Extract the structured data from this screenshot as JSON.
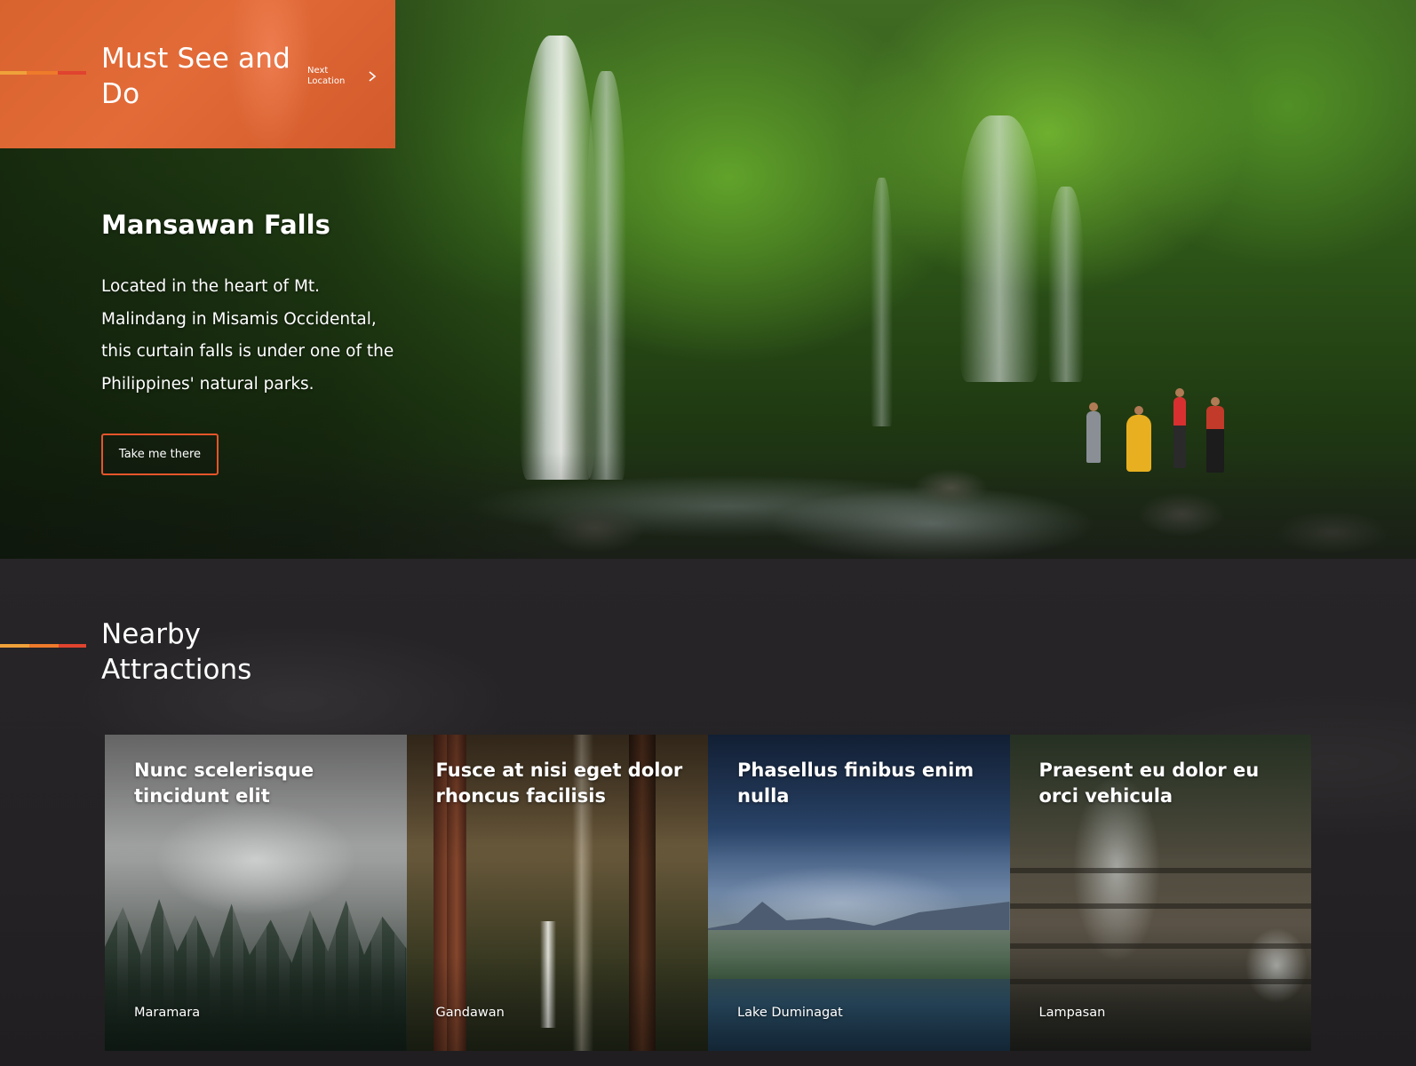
{
  "header": {
    "title": "Must See and Do",
    "next_label": "Next Location",
    "accent_colors": [
      "#f0a13a",
      "#ee7a2b",
      "#e0432f"
    ],
    "icon": "chevron-right-icon"
  },
  "hero": {
    "title": "Mansawan Falls",
    "description": "Located in the heart of Mt. Malindang in Misamis Occidental, this curtain falls is under one of the Philippines' natural parks.",
    "cta_label": "Take me there",
    "cta_border_color": "#e5552b"
  },
  "nearby": {
    "title": "Nearby Attractions",
    "cards": [
      {
        "title": "Nunc scelerisque tincidunt elit",
        "location": "Maramara"
      },
      {
        "title": "Fusce at nisi eget dolor rhoncus facilisis",
        "location": "Gandawan"
      },
      {
        "title": "Phasellus finibus enim nulla",
        "location": "Lake Duminagat"
      },
      {
        "title": "Praesent eu dolor eu orci vehicula",
        "location": "Lampasan"
      }
    ]
  }
}
